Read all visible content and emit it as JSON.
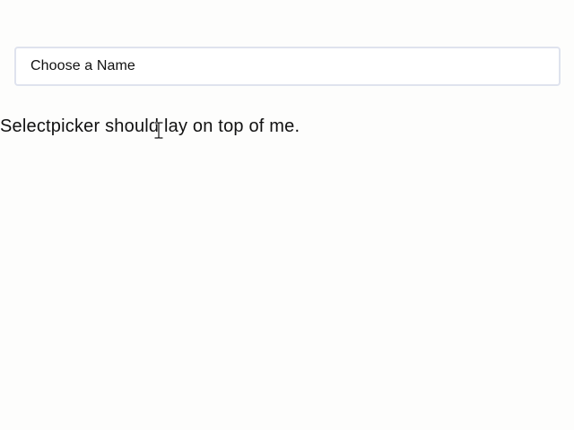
{
  "selectpicker": {
    "placeholder": "Choose a Name"
  },
  "caption": {
    "text": "Selectpicker should lay on top of me."
  },
  "cursor": {
    "icon": "text-cursor-icon"
  }
}
